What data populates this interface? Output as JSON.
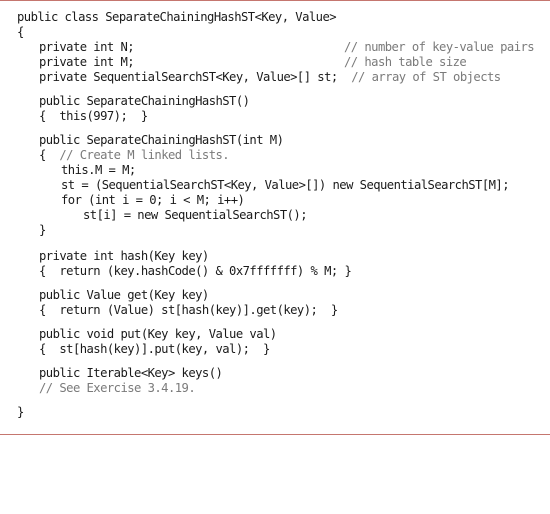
{
  "code_lines": [
    {
      "indent": 0,
      "code": "public class SeparateChainingHashST<Key, Value>",
      "comment": ""
    },
    {
      "indent": 0,
      "code": "{",
      "comment": ""
    },
    {
      "indent": 1,
      "code": "private int N;",
      "comment": "// number of key-value pairs"
    },
    {
      "indent": 1,
      "code": "private int M;",
      "comment": "// hash table size"
    },
    {
      "indent": 1,
      "code": "private SequentialSearchST<Key, Value>[] st;",
      "comment": "// array of ST objects"
    },
    {
      "indent": 1,
      "code": "public SeparateChainingHashST()",
      "comment": ""
    },
    {
      "indent": 1,
      "code": "{  this(997);  }",
      "comment": ""
    },
    {
      "indent": 1,
      "code": "public SeparateChainingHashST(int M)",
      "comment": ""
    },
    {
      "indent": 1,
      "code": "{",
      "comment": "// Create M linked lists."
    },
    {
      "indent": 2,
      "code": "this.M = M;",
      "comment": ""
    },
    {
      "indent": 2,
      "code": "st = (SequentialSearchST<Key, Value>[]) new SequentialSearchST[M];",
      "comment": ""
    },
    {
      "indent": 2,
      "code": "for (int i = 0; i < M; i++)",
      "comment": ""
    },
    {
      "indent": 3,
      "code": "st[i] = new SequentialSearchST();",
      "comment": ""
    },
    {
      "indent": 1,
      "code": "}",
      "comment": ""
    },
    {
      "indent": 1,
      "code": "private int hash(Key key)",
      "comment": ""
    },
    {
      "indent": 1,
      "code": "{  return (key.hashCode() & 0x7fffffff) % M; }",
      "comment": ""
    },
    {
      "indent": 1,
      "code": "public Value get(Key key)",
      "comment": ""
    },
    {
      "indent": 1,
      "code": "{  return (Value) st[hash(key)].get(key);  }",
      "comment": ""
    },
    {
      "indent": 1,
      "code": "public void put(Key key, Value val)",
      "comment": ""
    },
    {
      "indent": 1,
      "code": "{  st[hash(key)].put(key, val);  }",
      "comment": ""
    },
    {
      "indent": 1,
      "code": "public Iterable<Key> keys()",
      "comment": ""
    },
    {
      "indent": 1,
      "code": "",
      "comment": "// See Exercise 3.4.19."
    },
    {
      "indent": 0,
      "code": "}",
      "comment": ""
    }
  ]
}
